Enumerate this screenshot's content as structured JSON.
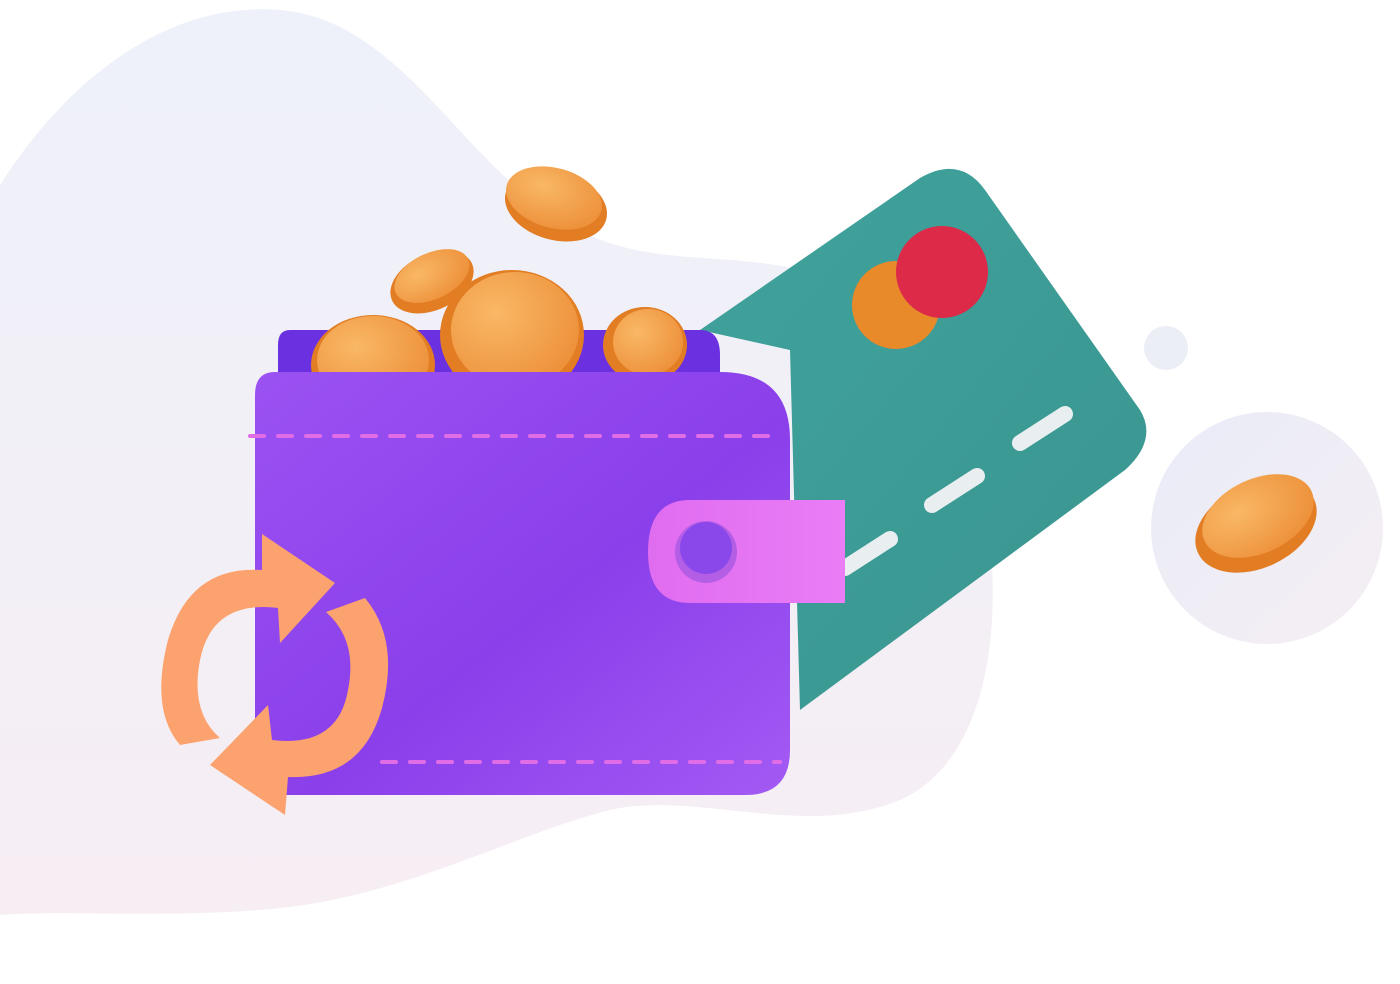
{
  "illustration": {
    "subject": "wallet-with-coins-and-card",
    "icons": [
      "wallet-icon",
      "coin-icon",
      "credit-card-icon",
      "refresh-icon"
    ],
    "colors": {
      "blob_light": "#eef1fa",
      "blob_pink": "#f6eef3",
      "wallet_purple": "#9a4ef0",
      "wallet_back": "#6d31e0",
      "strap_pink": "#e36ef2",
      "button_purple": "#8a48ea",
      "card_teal": "#3f9f9a",
      "card_orange": "#e88a2b",
      "card_red": "#dc2a48",
      "coin_orange": "#f3a24f",
      "coin_edge": "#e27d24",
      "refresh_orange": "#fba26e",
      "bubble": "#eceef7"
    }
  }
}
